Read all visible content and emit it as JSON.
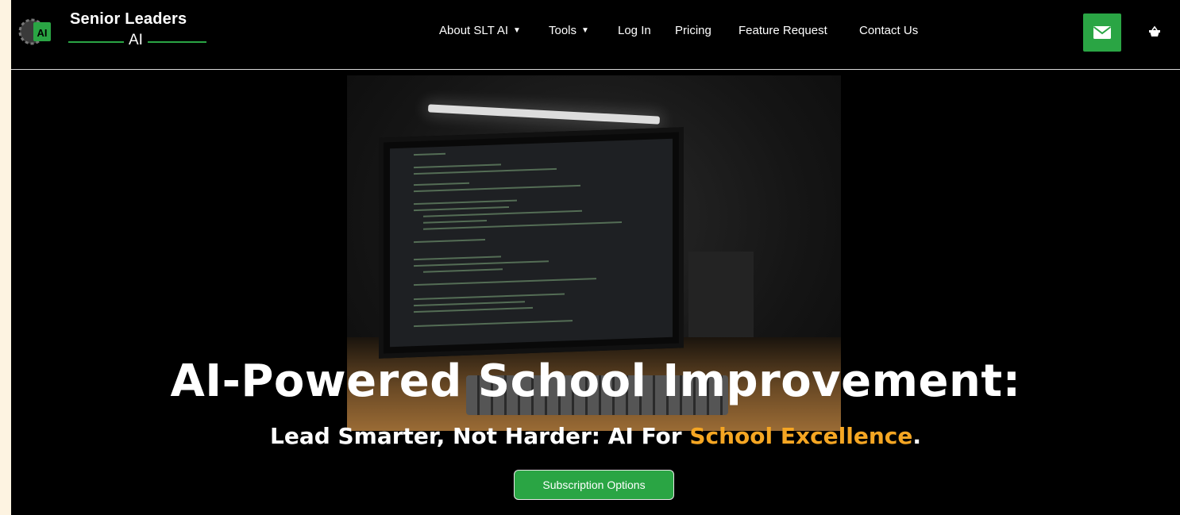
{
  "brand": {
    "title": "Senior Leaders",
    "subtitle": "AI",
    "logo_icon": "gear-ai-logo-icon"
  },
  "nav": {
    "items": [
      {
        "label": "About SLT AI",
        "has_caret": true
      },
      {
        "label": "Tools",
        "has_caret": true
      },
      {
        "label": "Log In",
        "has_caret": false
      },
      {
        "label": "Pricing",
        "has_caret": false
      },
      {
        "label": "Feature Request",
        "has_caret": false
      },
      {
        "label": "Contact Us",
        "has_caret": false
      }
    ],
    "caret_glyph": "▼"
  },
  "header_actions": {
    "mail_icon": "envelope-icon",
    "cart_icon": "shopping-basket-icon"
  },
  "hero": {
    "title": "AI-Powered School Improvement:",
    "subtitle_plain": "Lead Smarter, Not Harder: AI For ",
    "subtitle_accent": "School Excellence",
    "subtitle_end": ".",
    "cta_label": "Subscription Options",
    "background_image": "monitor-with-code-on-desk-photo"
  },
  "colors": {
    "brand_green": "#2aa544",
    "accent_orange": "#f5a623",
    "background": "#000000",
    "page_outer": "#fdf3e1"
  }
}
